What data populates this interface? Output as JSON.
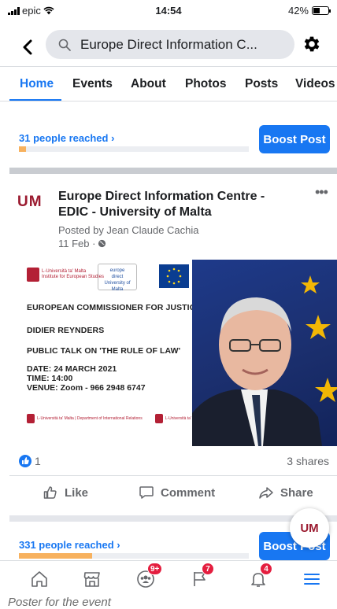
{
  "status_bar": {
    "carrier": "epic",
    "time": "14:54",
    "battery": "42%"
  },
  "header": {
    "search_text": "Europe Direct Information C..."
  },
  "tabs": [
    {
      "label": "Home",
      "active": true
    },
    {
      "label": "Events",
      "active": false
    },
    {
      "label": "About",
      "active": false
    },
    {
      "label": "Photos",
      "active": false
    },
    {
      "label": "Posts",
      "active": false
    },
    {
      "label": "Videos",
      "active": false
    }
  ],
  "reach_top": {
    "text": "31 people reached",
    "boost_label": "Boost Post",
    "progress": 0.03
  },
  "post": {
    "avatar_text": "UM",
    "title": "Europe Direct Information Centre - EDIC - University of Malta",
    "posted_by": "Posted by Jean Claude Cachia",
    "date": "11 Feb ·",
    "more": "•••",
    "poster": {
      "logo_left": "L-Università ta' Malta\nInstitute for European Studies",
      "ed_logo": "europe direct\nUniversity of Malta",
      "line1": "EUROPEAN COMMISSIONER FOR JUSTICE",
      "line2": "DIDIER REYNDERS",
      "line3": "PUBLIC TALK ON 'THE RULE OF LAW'",
      "date_line": "DATE:   24 MARCH 2021",
      "time_line": "TIME:    14:00",
      "venue_line": "VENUE: Zoom - 966 2948 6747",
      "footer_left": "L-Università ta' Malta | Department of International Relations",
      "footer_mid": "L-Università ta' Malta"
    },
    "reactions_count": "1",
    "shares": "3 shares",
    "actions": {
      "like": "Like",
      "comment": "Comment",
      "share": "Share"
    }
  },
  "reach_bottom": {
    "text": "331 people reached",
    "boost_label": "Boost Post",
    "progress": 0.32
  },
  "float_avatar": "UM",
  "bottom_nav": {
    "groups_badge": "9+",
    "pages_badge": "7",
    "notifications_badge": "4"
  },
  "caption": "Poster for the event",
  "colors": {
    "accent": "#1877f2",
    "badge": "#e41e3f",
    "um_red": "#9b1b30",
    "progress": "#f7b15e"
  }
}
